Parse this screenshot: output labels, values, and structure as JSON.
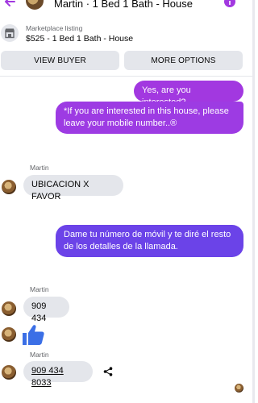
{
  "header": {
    "title": "Martin · 1 Bed 1 Bath - House"
  },
  "listing": {
    "label": "Marketplace listing",
    "price_title": "$525 - 1 Bed 1 Bath - House"
  },
  "buttons": {
    "view_buyer": "VIEW BUYER",
    "more_options": "MORE OPTIONS"
  },
  "messages": [
    {
      "from": "me",
      "text": "Yes, are you interested?"
    },
    {
      "from": "me",
      "text": "*If you are interested in this house, please leave your mobile number..®"
    },
    {
      "from": "Martin",
      "sender": "Martin",
      "text": "UBICACION X FAVOR"
    },
    {
      "from": "me",
      "text": "Dame tu número de móvil y te diré el resto de los detalles de la llamada."
    },
    {
      "from": "Martin",
      "sender": "Martin",
      "text": "909 434"
    },
    {
      "from": "Martin",
      "sender": "Martin",
      "text": "909 434 8033"
    }
  ],
  "colors": {
    "accent": "#a238e0",
    "outgoing_1": "#a238e0",
    "outgoing_2": "#9d3be3",
    "outgoing_3": "#6b43e8",
    "incoming": "#e4e6eb",
    "like": "#3b6fe6"
  }
}
